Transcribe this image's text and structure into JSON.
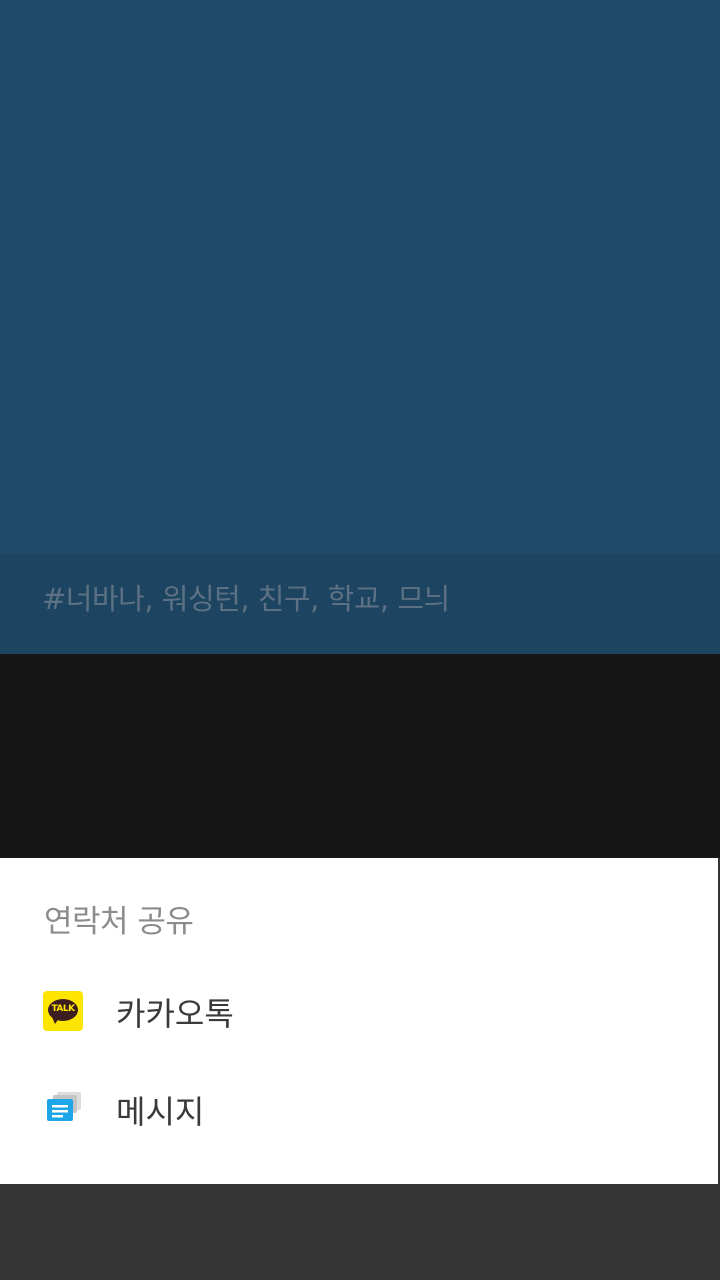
{
  "card": {
    "tags": "#너바나, 워싱턴, 친구, 학교, 므늬"
  },
  "share_sheet": {
    "title": "연락처 공유",
    "items": [
      {
        "label": "카카오톡",
        "icon": "kakaotalk-icon"
      },
      {
        "label": "메시지",
        "icon": "messages-icon"
      }
    ]
  },
  "icons": {
    "kakao_talk_text": "TALK"
  },
  "colors": {
    "card_background": "#1f4a69",
    "tag_bar": "#1d4460",
    "tag_text": "#5c7184",
    "scrim": "#161616",
    "sheet_background": "#ffffff",
    "kakao_yellow": "#fee500",
    "messages_blue": "#1ea7e8"
  }
}
